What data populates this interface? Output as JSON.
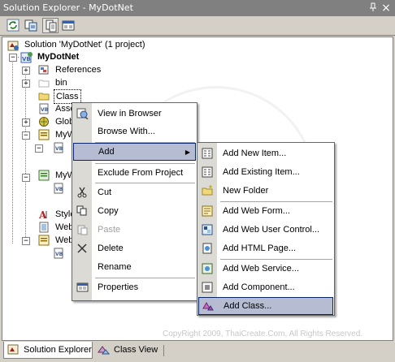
{
  "window": {
    "title": "Solution Explorer - MyDotNet",
    "pin_glyph": "█",
    "close_glyph": "×"
  },
  "toolbar": {
    "buttons": [
      "refresh-icon",
      "copy-website-icon",
      "show-all-files-icon",
      "properties-icon"
    ]
  },
  "tree": {
    "solution": "Solution 'MyDotNet' (1 project)",
    "project": "MyDotNet",
    "items": [
      {
        "label": "References",
        "icon": "references-icon"
      },
      {
        "label": "bin",
        "icon": "folder-icon"
      },
      {
        "label": "Class",
        "icon": "folder-icon",
        "selected": true
      },
      {
        "label": "Asse",
        "icon": "vb-file-icon"
      },
      {
        "label": "Glob",
        "icon": "global-icon"
      },
      {
        "label": "MyW",
        "icon": "webform-icon"
      },
      {
        "label": "MyW",
        "icon": "webform-icon"
      },
      {
        "label": "Style",
        "icon": "stylesheet-icon"
      },
      {
        "label": "Web",
        "icon": "web-config-icon"
      },
      {
        "label": "Web",
        "icon": "webform-icon"
      }
    ]
  },
  "context_menu": {
    "items": [
      {
        "label": "View in Browser",
        "icon": "browser-icon"
      },
      {
        "label": "Browse With...",
        "icon": ""
      },
      {
        "label": "Add",
        "icon": "",
        "submenu": true,
        "highlighted": true
      },
      {
        "label": "Exclude From Project",
        "icon": ""
      },
      {
        "label": "Cut",
        "icon": "cut-icon"
      },
      {
        "label": "Copy",
        "icon": "copy-icon"
      },
      {
        "label": "Paste",
        "icon": "paste-icon",
        "disabled": true
      },
      {
        "label": "Delete",
        "icon": "delete-icon"
      },
      {
        "label": "Rename",
        "icon": ""
      },
      {
        "label": "Properties",
        "icon": "properties-icon"
      }
    ]
  },
  "add_submenu": {
    "items": [
      {
        "label": "Add New Item...",
        "icon": "new-item-icon"
      },
      {
        "label": "Add Existing Item...",
        "icon": "existing-item-icon"
      },
      {
        "label": "New Folder",
        "icon": "new-folder-icon"
      },
      {
        "label": "Add Web Form...",
        "icon": "web-form-icon"
      },
      {
        "label": "Add Web User Control...",
        "icon": "user-control-icon"
      },
      {
        "label": "Add HTML Page...",
        "icon": "html-page-icon"
      },
      {
        "label": "Add Web Service...",
        "icon": "web-service-icon"
      },
      {
        "label": "Add Component...",
        "icon": "component-icon"
      },
      {
        "label": "Add Class...",
        "icon": "class-icon",
        "highlighted": true
      }
    ]
  },
  "tabs": [
    {
      "label": "Solution Explorer",
      "active": true
    },
    {
      "label": "Class View",
      "active": false
    }
  ],
  "copyright": "CopyRight 2009, ThaiCreate.Com, All Rights Reserved.",
  "colors": {
    "highlight": "#b6bdd2",
    "highlight_border": "#0a246a",
    "title_bar": "#808080"
  }
}
